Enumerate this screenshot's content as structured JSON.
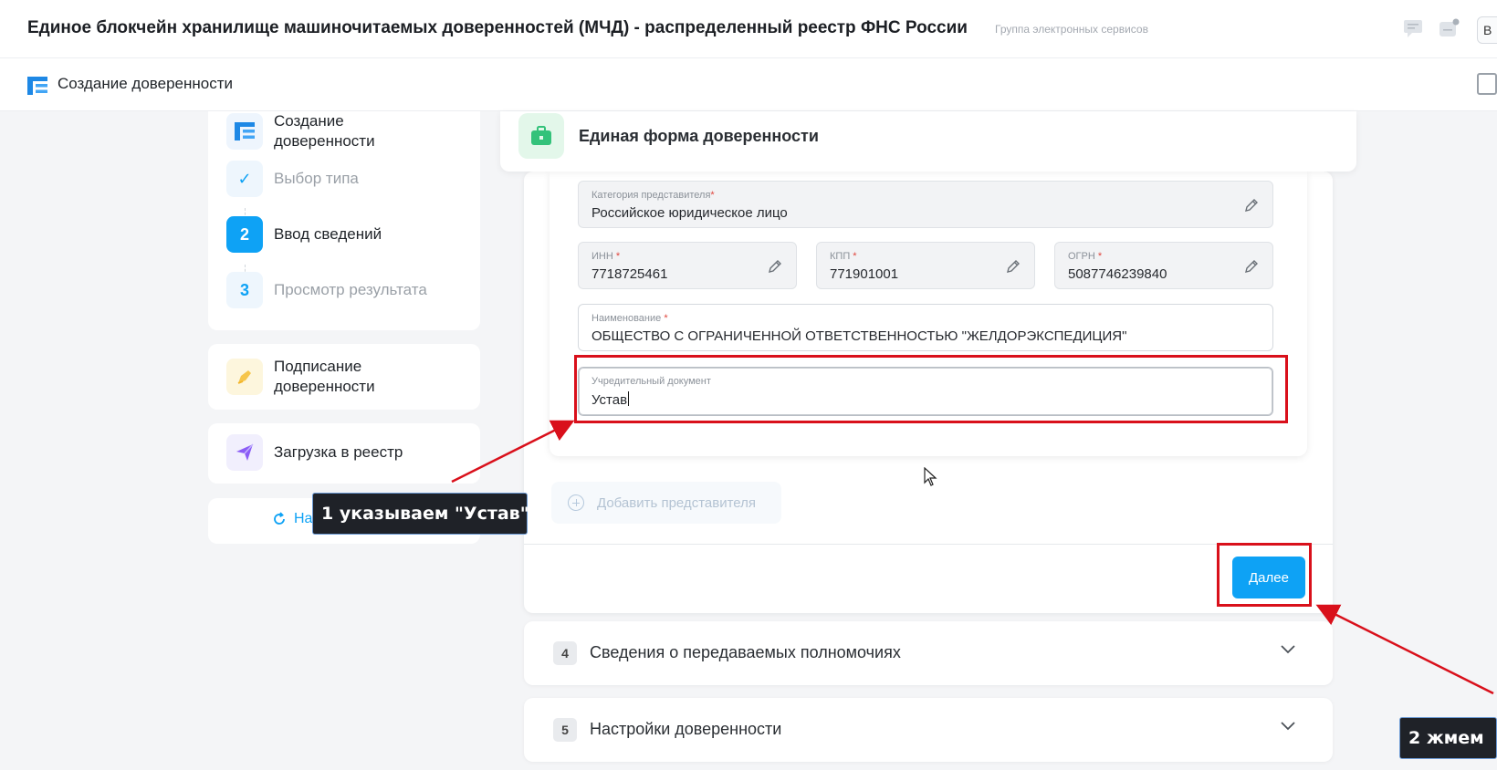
{
  "header": {
    "title": "Единое блокчейн хранилище машиночитаемых доверенностей (МЧД) - распределенный реестр ФНС России",
    "subtitle": "Группа электронных сервисов",
    "avatar_letter": "В"
  },
  "page": {
    "title": "Создание доверенности"
  },
  "steps": {
    "create": {
      "label": "Создание доверенности"
    },
    "items": [
      {
        "badge": "✓",
        "label": "Выбор типа"
      },
      {
        "badge": "2",
        "label": "Ввод сведений"
      },
      {
        "badge": "3",
        "label": "Просмотр результата"
      }
    ],
    "sign": {
      "label": "Подписание доверенности"
    },
    "upload": {
      "label": "Загрузка в реестр"
    },
    "restart": {
      "label": "Начать сначала"
    }
  },
  "form": {
    "title": "Единая форма доверенности",
    "fields": {
      "category": {
        "label": "Категория представителя",
        "value": "Российское юридическое лицо"
      },
      "inn": {
        "label": "ИНН",
        "value": "7718725461"
      },
      "kpp": {
        "label": "КПП",
        "value": "771901001"
      },
      "ogrn": {
        "label": "ОГРН",
        "value": "5087746239840"
      },
      "name": {
        "label": "Наименование",
        "value": "ОБЩЕСТВО С ОГРАНИЧЕННОЙ ОТВЕТСТВЕННОСТЬЮ \"ЖЕЛДОРЭКСПЕДИЦИЯ\""
      },
      "founding_doc": {
        "label": "Учредительный документ",
        "value": "Устав"
      }
    },
    "required_mark": "*",
    "add_representative": "Добавить представителя",
    "next_button": "Далее"
  },
  "sections": [
    {
      "number": "4",
      "title": "Сведения о передаваемых полномочиях"
    },
    {
      "number": "5",
      "title": "Настройки доверенности"
    }
  ],
  "annotations": {
    "callout_1": "1 указываем \"Устав\"",
    "callout_2": "2 жмем"
  },
  "colors": {
    "accent": "#0ea2f5",
    "highlight": "#d9101b",
    "callout_bg": "#1f2228"
  }
}
